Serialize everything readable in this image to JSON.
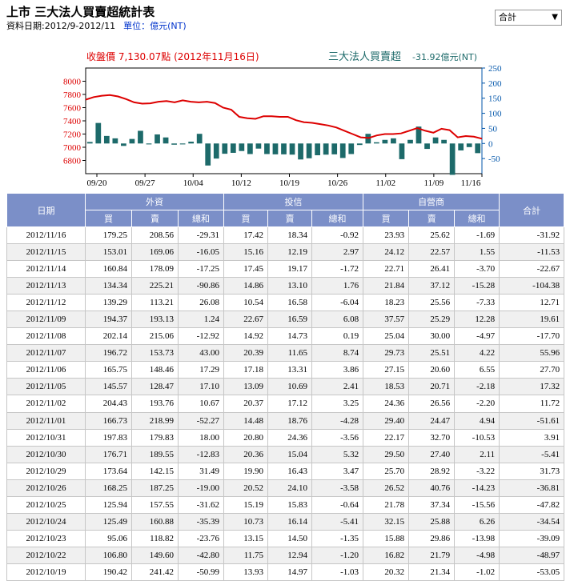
{
  "header": {
    "title": "上市 三大法人買賣超統計表",
    "period": "資料日期:2012/9-2012/11",
    "unit": "單位：億元(NT)"
  },
  "filter": {
    "selected": "合計"
  },
  "colors": {
    "close_line": "#dd0000",
    "bars": "#1d6a6a",
    "right_axis": "#0055aa",
    "header_bg": "#7b8fc8"
  },
  "chart_legend": {
    "close_label": "收盤價 7,130.07點 (2012年11月16日)",
    "net_label": "三大法人買賣超",
    "net_value": "-31.92億元(NT)"
  },
  "chart_data": {
    "type": "line+bar",
    "x": [
      "09/17",
      "09/18",
      "09/19",
      "09/20",
      "09/21",
      "09/24",
      "09/25",
      "09/26",
      "09/27",
      "09/28",
      "10/01",
      "10/02",
      "10/03",
      "10/04",
      "10/05",
      "10/08",
      "10/09",
      "10/11",
      "10/12",
      "10/15",
      "10/16",
      "10/17",
      "10/18",
      "10/19",
      "10/22",
      "10/23",
      "10/24",
      "10/25",
      "10/26",
      "10/29",
      "10/30",
      "10/31",
      "11/01",
      "11/02",
      "11/05",
      "11/06",
      "11/07",
      "11/08",
      "11/09",
      "11/12",
      "11/13",
      "11/14",
      "11/15",
      "11/16"
    ],
    "xticks": [
      "09/20",
      "09/27",
      "10/04",
      "10/12",
      "10/19",
      "10/26",
      "11/02",
      "11/09",
      "11/16"
    ],
    "series": [
      {
        "axis": "left",
        "kind": "line",
        "values": [
          7720,
          7760,
          7780,
          7790,
          7770,
          7730,
          7680,
          7660,
          7665,
          7690,
          7700,
          7680,
          7710,
          7690,
          7680,
          7690,
          7670,
          7600,
          7570,
          7460,
          7440,
          7430,
          7470,
          7470,
          7460,
          7460,
          7410,
          7380,
          7370,
          7350,
          7330,
          7300,
          7250,
          7200,
          7150,
          7140,
          7180,
          7200,
          7200,
          7210,
          7250,
          7290,
          7250,
          7220,
          7280,
          7260,
          7150,
          7170,
          7160,
          7130
        ]
      },
      {
        "axis": "right",
        "kind": "bar",
        "values": [
          5,
          68,
          25,
          17,
          -8,
          15,
          42,
          -3,
          30,
          20,
          -4,
          -3,
          6,
          32,
          -73,
          -50,
          -34,
          -31,
          -25,
          -35,
          -17,
          -35,
          -36,
          -36,
          -37,
          -53,
          -49,
          -39,
          -37,
          -36,
          -48,
          -35,
          -5,
          32,
          4,
          12,
          17,
          -52,
          12,
          56,
          -18,
          20,
          12,
          -104,
          -23,
          -12,
          -32
        ]
      }
    ],
    "ylim_left": [
      6600,
      8200
    ],
    "yticks_left": [
      6800,
      7000,
      7200,
      7400,
      7600,
      7800,
      8000
    ],
    "ylim_right": [
      -100,
      250
    ],
    "yticks_right": [
      -50,
      0,
      50,
      100,
      150,
      200,
      250
    ],
    "grid": false
  },
  "table": {
    "headers": {
      "date": "日期",
      "foreign": "外資",
      "trust": "投信",
      "dealer": "自營商",
      "total": "合計",
      "buy": "買",
      "sell": "賣",
      "net": "總和"
    },
    "rows": [
      [
        "2012/11/16",
        "179.25",
        "208.56",
        "-29.31",
        "17.42",
        "18.34",
        "-0.92",
        "23.93",
        "25.62",
        "-1.69",
        "-31.92"
      ],
      [
        "2012/11/15",
        "153.01",
        "169.06",
        "-16.05",
        "15.16",
        "12.19",
        "2.97",
        "24.12",
        "22.57",
        "1.55",
        "-11.53"
      ],
      [
        "2012/11/14",
        "160.84",
        "178.09",
        "-17.25",
        "17.45",
        "19.17",
        "-1.72",
        "22.71",
        "26.41",
        "-3.70",
        "-22.67"
      ],
      [
        "2012/11/13",
        "134.34",
        "225.21",
        "-90.86",
        "14.86",
        "13.10",
        "1.76",
        "21.84",
        "37.12",
        "-15.28",
        "-104.38"
      ],
      [
        "2012/11/12",
        "139.29",
        "113.21",
        "26.08",
        "10.54",
        "16.58",
        "-6.04",
        "18.23",
        "25.56",
        "-7.33",
        "12.71"
      ],
      [
        "2012/11/09",
        "194.37",
        "193.13",
        "1.24",
        "22.67",
        "16.59",
        "6.08",
        "37.57",
        "25.29",
        "12.28",
        "19.61"
      ],
      [
        "2012/11/08",
        "202.14",
        "215.06",
        "-12.92",
        "14.92",
        "14.73",
        "0.19",
        "25.04",
        "30.00",
        "-4.97",
        "-17.70"
      ],
      [
        "2012/11/07",
        "196.72",
        "153.73",
        "43.00",
        "20.39",
        "11.65",
        "8.74",
        "29.73",
        "25.51",
        "4.22",
        "55.96"
      ],
      [
        "2012/11/06",
        "165.75",
        "148.46",
        "17.29",
        "17.18",
        "13.31",
        "3.86",
        "27.15",
        "20.60",
        "6.55",
        "27.70"
      ],
      [
        "2012/11/05",
        "145.57",
        "128.47",
        "17.10",
        "13.09",
        "10.69",
        "2.41",
        "18.53",
        "20.71",
        "-2.18",
        "17.32"
      ],
      [
        "2012/11/02",
        "204.43",
        "193.76",
        "10.67",
        "20.37",
        "17.12",
        "3.25",
        "24.36",
        "26.56",
        "-2.20",
        "11.72"
      ],
      [
        "2012/11/01",
        "166.73",
        "218.99",
        "-52.27",
        "14.48",
        "18.76",
        "-4.28",
        "29.40",
        "24.47",
        "4.94",
        "-51.61"
      ],
      [
        "2012/10/31",
        "197.83",
        "179.83",
        "18.00",
        "20.80",
        "24.36",
        "-3.56",
        "22.17",
        "32.70",
        "-10.53",
        "3.91"
      ],
      [
        "2012/10/30",
        "176.71",
        "189.55",
        "-12.83",
        "20.36",
        "15.04",
        "5.32",
        "29.50",
        "27.40",
        "2.11",
        "-5.41"
      ],
      [
        "2012/10/29",
        "173.64",
        "142.15",
        "31.49",
        "19.90",
        "16.43",
        "3.47",
        "25.70",
        "28.92",
        "-3.22",
        "31.73"
      ],
      [
        "2012/10/26",
        "168.25",
        "187.25",
        "-19.00",
        "20.52",
        "24.10",
        "-3.58",
        "26.52",
        "40.76",
        "-14.23",
        "-36.81"
      ],
      [
        "2012/10/25",
        "125.94",
        "157.55",
        "-31.62",
        "15.19",
        "15.83",
        "-0.64",
        "21.78",
        "37.34",
        "-15.56",
        "-47.82"
      ],
      [
        "2012/10/24",
        "125.49",
        "160.88",
        "-35.39",
        "10.73",
        "16.14",
        "-5.41",
        "32.15",
        "25.88",
        "6.26",
        "-34.54"
      ],
      [
        "2012/10/23",
        "95.06",
        "118.82",
        "-23.76",
        "13.15",
        "14.50",
        "-1.35",
        "15.88",
        "29.86",
        "-13.98",
        "-39.09"
      ],
      [
        "2012/10/22",
        "106.80",
        "149.60",
        "-42.80",
        "11.75",
        "12.94",
        "-1.20",
        "16.82",
        "21.79",
        "-4.98",
        "-48.97"
      ],
      [
        "2012/10/19",
        "190.42",
        "241.42",
        "-50.99",
        "13.93",
        "14.97",
        "-1.03",
        "20.32",
        "21.34",
        "-1.02",
        "-53.05"
      ]
    ]
  }
}
